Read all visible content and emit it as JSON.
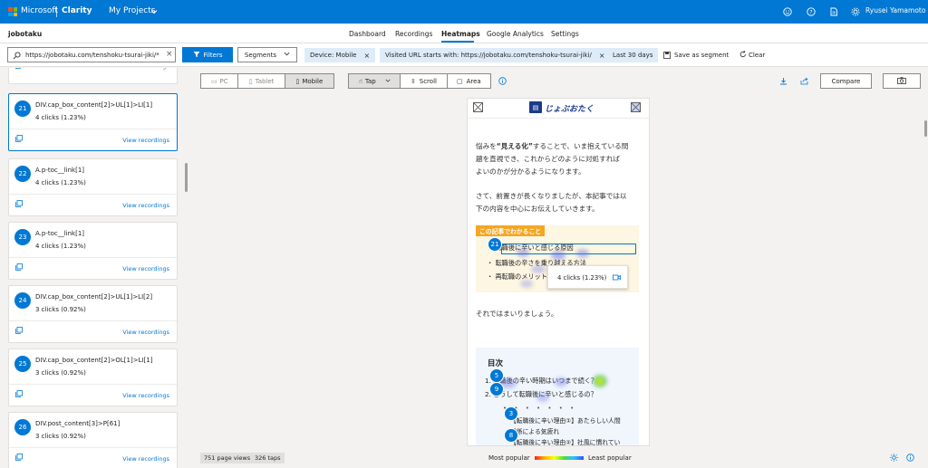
{
  "topbar": {
    "brand": "Microsoft",
    "product": "Clarity",
    "projects": "My Projects",
    "user": "Ryusei Yamamoto",
    "icons": [
      "smiley-icon",
      "help-icon",
      "document-icon",
      "settings-icon"
    ]
  },
  "nav": {
    "project": "jobotaku",
    "tabs": [
      "Dashboard",
      "Recordings",
      "Heatmaps",
      "Google Analytics",
      "Settings"
    ],
    "active_tab": "Heatmaps"
  },
  "filterbar": {
    "url_value": "https://jobotaku.com/tenshoku-tsurai-jiki/*",
    "filters_label": "Filters",
    "segments_label": "Segments",
    "chips": [
      "Device: Mobile",
      "Visited URL starts with: https://jobotaku.com/tenshoku-tsurai-jiki/",
      "Last 30 days"
    ],
    "save_segment": "Save as segment",
    "clear": "Clear"
  },
  "sidebar": {
    "view_recordings": "View recordings",
    "cards": [
      {
        "num": "21",
        "name": "DIV.cap_box_content[2]>UL[1]>LI[1]",
        "clicks": "4 clicks (1.23%)"
      },
      {
        "num": "22",
        "name": "A.p-toc__link[1]",
        "clicks": "4 clicks (1.23%)"
      },
      {
        "num": "23",
        "name": "A.p-toc__link[1]",
        "clicks": "4 clicks (1.23%)"
      },
      {
        "num": "24",
        "name": "DIV.cap_box_content[2]>UL[1]>LI[2]",
        "clicks": "3 clicks (0.92%)"
      },
      {
        "num": "25",
        "name": "DIV.cap_box_content[2]>OL[1]>LI[1]",
        "clicks": "3 clicks (0.92%)"
      },
      {
        "num": "26",
        "name": "DIV.post_content[3]>P[61]",
        "clicks": "3 clicks (0.92%)"
      }
    ]
  },
  "toolbar": {
    "devices": [
      "PC",
      "Tablet",
      "Mobile"
    ],
    "active_device": "Mobile",
    "modes": [
      "Tap",
      "Scroll",
      "Area"
    ],
    "active_mode": "Tap",
    "compare": "Compare"
  },
  "page": {
    "logo_text": "じょぶおたく",
    "p1_line1_a": "悩みを",
    "p1_line1_b": "“見える化”",
    "p1_line1_c": "することで、いま抱えている問",
    "p1_line2": "題を直視でき、これからどのように対処すれば",
    "p1_line3": "よいのかが分かるようになります。",
    "p2_line1": "さて、前置きが長くなりましたが、本記事では以",
    "p2_line2": "下の内容を中心にお伝えしていきます。",
    "box_title": "この記事でわかること",
    "box_items": [
      "転職後に辛いと感じる原因",
      "転職後の辛さを乗り越える方法",
      "再転職のメリット"
    ],
    "tooltip": "4 clicks (1.23%)",
    "p3": "それではまいりましょう。",
    "toc_title": "目次",
    "toc_items": [
      "1. 転職後の辛い時期はいつまで続く？",
      "2. どうして転職後に辛いと感じるの？",
      "【転職後に辛い理由①】あたらしい人間",
      "関係による気疲れ",
      "【転職後に辛い理由②】社風に慣れてい"
    ],
    "markers": [
      "21",
      "5",
      "9",
      "3",
      "8"
    ]
  },
  "footer": {
    "page_views": "751 page views",
    "taps": "326 taps",
    "most": "Most popular",
    "least": "Least popular"
  },
  "colors": {
    "accent": "#0078d4",
    "highlight_bg": "#f5a623",
    "box_bg": "#fdf6e3"
  }
}
